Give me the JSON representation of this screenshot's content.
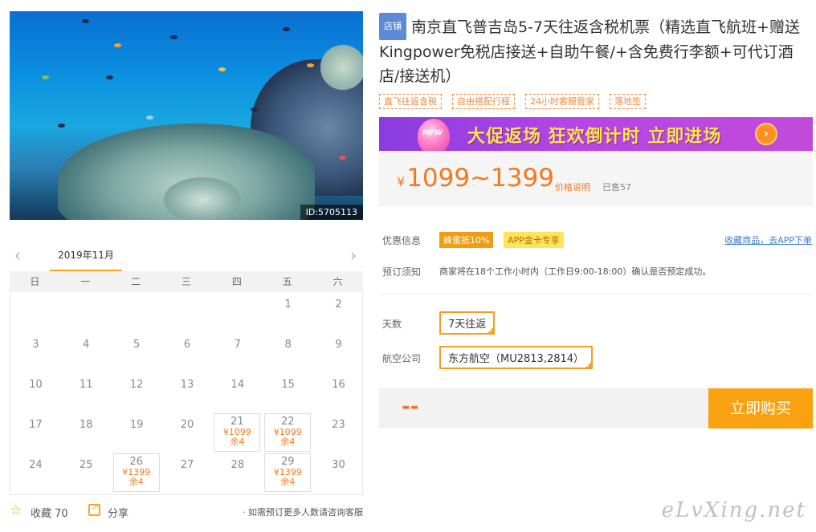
{
  "hero": {
    "id_label": "ID:5705113"
  },
  "product": {
    "shop_badge": "店铺",
    "title": "南京直飞普吉岛5-7天往返含税机票（精选直飞航班+赠送Kingpower免税店接送+自助午餐/+含免费行李额+可代订酒店/接送机）",
    "tags": [
      "直飞往返含税",
      "自由搭配行程",
      "24小时客服管家",
      "落地签"
    ]
  },
  "promo": {
    "balloon_text": "MFW",
    "text": "大促返场 狂欢倒计时 立即进场",
    "arrow": "›"
  },
  "price": {
    "currency": "¥",
    "range": "1099~1399",
    "note": "价格说明",
    "sold": "已售57"
  },
  "info": {
    "discount_label": "优惠信息",
    "coupon_a": "蜂蜜抵10%",
    "coupon_b": "APP金卡专享",
    "fav_link": "收藏商品，去APP下单",
    "booking_label": "预订须知",
    "booking_text": "商家将在18个工作小时内（工作日9:00-18:00）确认是否预定成功。",
    "days_label": "天数",
    "days_value": "7天往返",
    "airline_label": "航空公司",
    "airline_value": "东方航空（MU2813,2814）"
  },
  "buy": {
    "total": "--",
    "button": "立即购买"
  },
  "calendar": {
    "month": "2019年11月",
    "prev": "‹",
    "next": "›",
    "weekdays": [
      "日",
      "一",
      "二",
      "三",
      "四",
      "五",
      "六"
    ],
    "days": [
      {
        "d": "1",
        "col": 5,
        "row": 0
      },
      {
        "d": "2",
        "col": 6,
        "row": 0
      },
      {
        "d": "3",
        "col": 0,
        "row": 1
      },
      {
        "d": "4",
        "col": 1,
        "row": 1
      },
      {
        "d": "5",
        "col": 2,
        "row": 1
      },
      {
        "d": "6",
        "col": 3,
        "row": 1
      },
      {
        "d": "7",
        "col": 4,
        "row": 1
      },
      {
        "d": "8",
        "col": 5,
        "row": 1
      },
      {
        "d": "9",
        "col": 6,
        "row": 1
      },
      {
        "d": "10",
        "col": 0,
        "row": 2
      },
      {
        "d": "11",
        "col": 1,
        "row": 2
      },
      {
        "d": "12",
        "col": 2,
        "row": 2
      },
      {
        "d": "13",
        "col": 3,
        "row": 2
      },
      {
        "d": "14",
        "col": 4,
        "row": 2
      },
      {
        "d": "15",
        "col": 5,
        "row": 2
      },
      {
        "d": "16",
        "col": 6,
        "row": 2
      },
      {
        "d": "17",
        "col": 0,
        "row": 3
      },
      {
        "d": "18",
        "col": 1,
        "row": 3
      },
      {
        "d": "19",
        "col": 2,
        "row": 3
      },
      {
        "d": "20",
        "col": 3,
        "row": 3
      },
      {
        "d": "21",
        "col": 4,
        "row": 3,
        "price": "¥1099",
        "remain": "余4"
      },
      {
        "d": "22",
        "col": 5,
        "row": 3,
        "price": "¥1099",
        "remain": "余4"
      },
      {
        "d": "23",
        "col": 6,
        "row": 3
      },
      {
        "d": "24",
        "col": 0,
        "row": 4
      },
      {
        "d": "25",
        "col": 1,
        "row": 4
      },
      {
        "d": "26",
        "col": 2,
        "row": 4,
        "price": "¥1399",
        "remain": "余4"
      },
      {
        "d": "27",
        "col": 3,
        "row": 4
      },
      {
        "d": "28",
        "col": 4,
        "row": 4
      },
      {
        "d": "29",
        "col": 5,
        "row": 4,
        "price": "¥1399",
        "remain": "余4"
      },
      {
        "d": "30",
        "col": 6,
        "row": 4
      }
    ]
  },
  "footer": {
    "fav": "收藏 70",
    "share": "分享",
    "note": "· 如需预订更多人数请咨询客服"
  },
  "watermark": "eLvXing.net"
}
